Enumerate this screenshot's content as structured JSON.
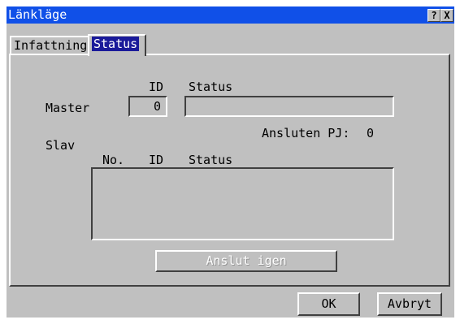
{
  "window": {
    "title": "Länkläge",
    "help_glyph": "?",
    "close_glyph": "X"
  },
  "tabs": [
    {
      "label": "Infattning",
      "selected": false
    },
    {
      "label": "Status",
      "selected": true
    }
  ],
  "master": {
    "label": "Master",
    "id_header": "ID",
    "status_header": "Status",
    "id_value": "0",
    "status_value": ""
  },
  "connected": {
    "label": "Ansluten PJ:",
    "value": "0"
  },
  "slave": {
    "label": "Slav",
    "columns": [
      "No.",
      "ID",
      "Status"
    ],
    "rows": []
  },
  "buttons": {
    "reconnect": "Anslut igen",
    "ok": "OK",
    "cancel": "Avbryt"
  }
}
